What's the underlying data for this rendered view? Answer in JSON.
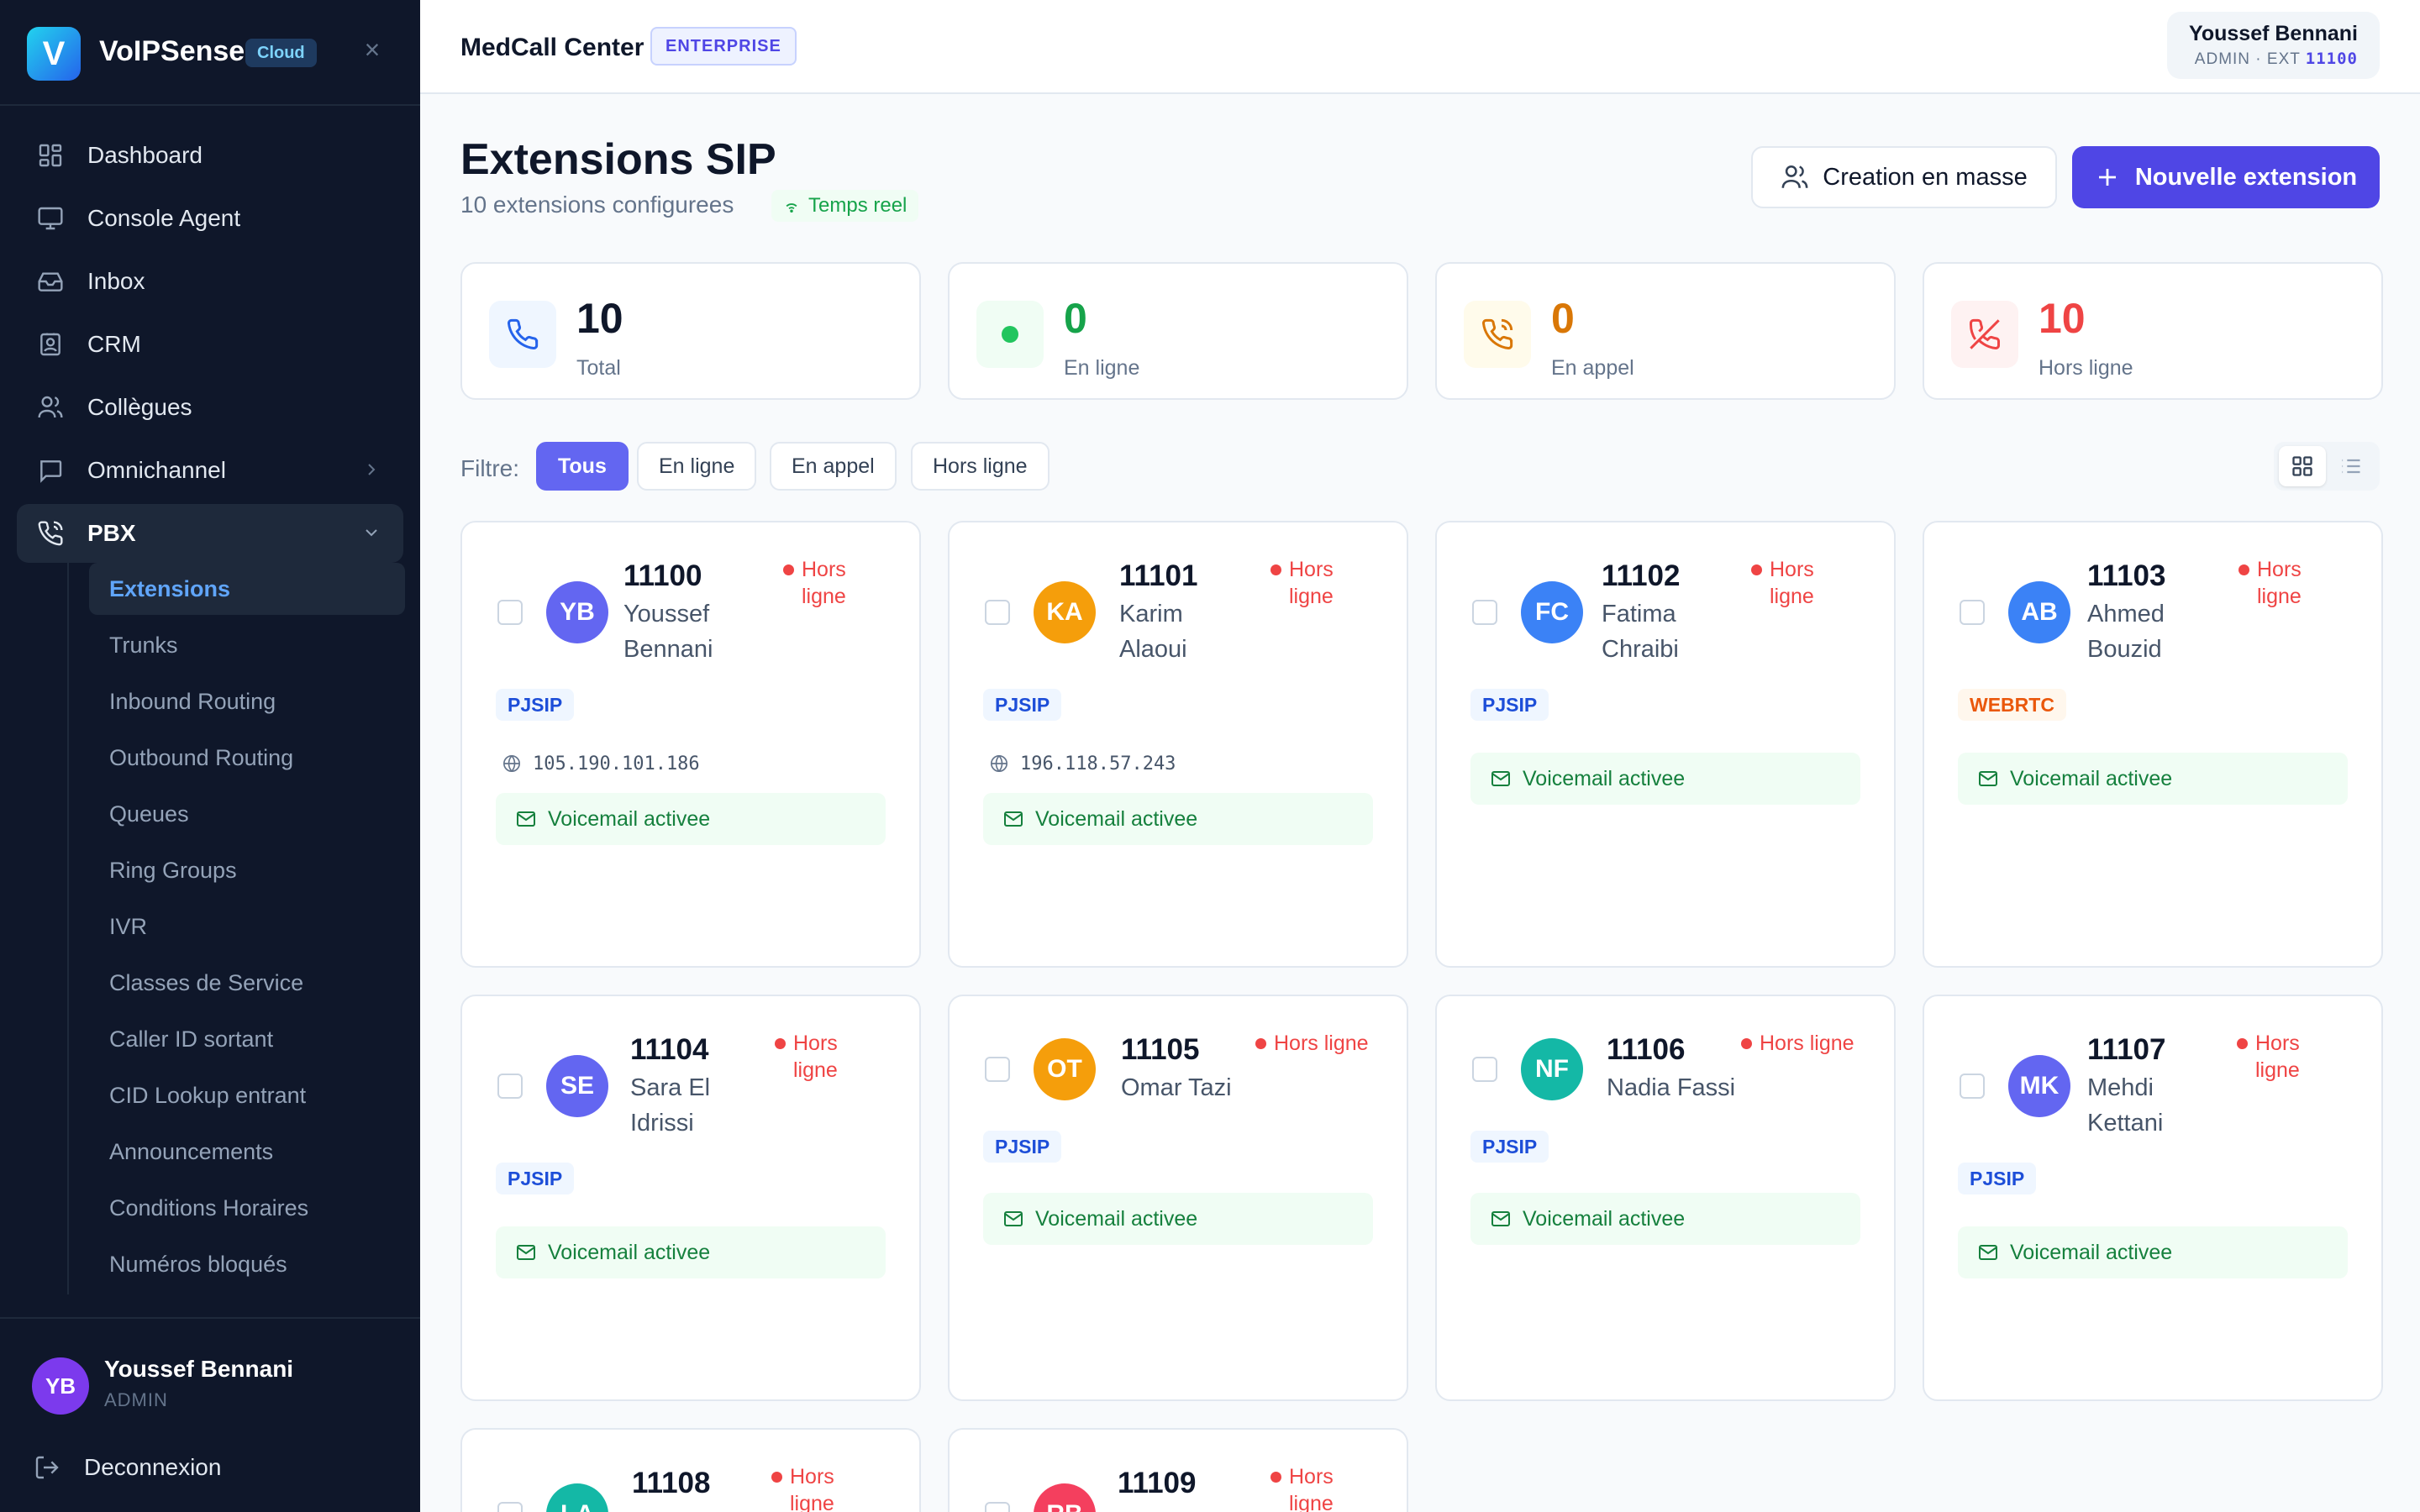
{
  "brand": {
    "logo": "V",
    "name": "VoIPSense",
    "badge": "Cloud",
    "close": "×"
  },
  "nav": [
    {
      "label": "Dashboard",
      "icon": "grid-icon"
    },
    {
      "label": "Console Agent",
      "icon": "monitor-icon"
    },
    {
      "label": "Inbox",
      "icon": "inbox-icon"
    },
    {
      "label": "CRM",
      "icon": "contact-icon"
    },
    {
      "label": "Collègues",
      "icon": "users-icon"
    },
    {
      "label": "Omnichannel",
      "icon": "chat-icon"
    },
    {
      "label": "PBX",
      "icon": "phone-icon"
    }
  ],
  "subnav": [
    "Extensions",
    "Trunks",
    "Inbound Routing",
    "Outbound Routing",
    "Queues",
    "Ring Groups",
    "IVR",
    "Classes de Service",
    "Caller ID sortant",
    "CID Lookup entrant",
    "Announcements",
    "Conditions Horaires",
    "Numéros bloqués"
  ],
  "sidebar_user": {
    "initials": "YB",
    "name": "Youssef Bennani",
    "role": "ADMIN",
    "logout": "Deconnexion"
  },
  "header": {
    "org": "MedCall Center",
    "plan": "ENTERPRISE",
    "user_name": "Youssef Bennani",
    "user_role": "ADMIN · EXT ",
    "user_ext": "11100"
  },
  "page": {
    "title": "Extensions SIP",
    "subtitle": "10 extensions configurees",
    "realtime": "Temps reel",
    "bulk_button": "Creation en masse",
    "new_button": "Nouvelle extension"
  },
  "stats": [
    {
      "value": "10",
      "label": "Total",
      "color": "#0f172a"
    },
    {
      "value": "0",
      "label": "En ligne",
      "color": "#16a34a"
    },
    {
      "value": "0",
      "label": "En appel",
      "color": "#d97706"
    },
    {
      "value": "10",
      "label": "Hors ligne",
      "color": "#ef4444"
    }
  ],
  "filter": {
    "label": "Filtre:",
    "options": [
      "Tous",
      "En ligne",
      "En appel",
      "Hors ligne"
    ],
    "selected": "Tous"
  },
  "extensions": [
    {
      "ext": "11100",
      "name": "Youssef Bennani",
      "initials": "YB",
      "color": "#6366f1",
      "status": "Hors ligne",
      "protocol": "PJSIP",
      "ip": "105.190.101.186",
      "voicemail": "Voicemail activee"
    },
    {
      "ext": "11101",
      "name": "Karim Alaoui",
      "initials": "KA",
      "color": "#f59e0b",
      "status": "Hors ligne",
      "protocol": "PJSIP",
      "ip": "196.118.57.243",
      "voicemail": "Voicemail activee"
    },
    {
      "ext": "11102",
      "name": "Fatima Chraibi",
      "initials": "FC",
      "color": "#3b82f6",
      "status": "Hors ligne",
      "protocol": "PJSIP",
      "ip": "",
      "voicemail": "Voicemail activee"
    },
    {
      "ext": "11103",
      "name": "Ahmed Bouzid",
      "initials": "AB",
      "color": "#3b82f6",
      "status": "Hors ligne",
      "protocol": "WEBRTC",
      "ip": "",
      "voicemail": "Voicemail activee"
    },
    {
      "ext": "11104",
      "name": "Sara El Idrissi",
      "initials": "SE",
      "color": "#6366f1",
      "status": "Hors ligne",
      "protocol": "PJSIP",
      "ip": "",
      "voicemail": "Voicemail activee"
    },
    {
      "ext": "11105",
      "name": "Omar Tazi",
      "initials": "OT",
      "color": "#f59e0b",
      "status": "Hors ligne",
      "protocol": "PJSIP",
      "ip": "",
      "voicemail": "Voicemail activee"
    },
    {
      "ext": "11106",
      "name": "Nadia Fassi",
      "initials": "NF",
      "color": "#14b8a6",
      "status": "Hors ligne",
      "protocol": "PJSIP",
      "ip": "",
      "voicemail": "Voicemail activee"
    },
    {
      "ext": "11107",
      "name": "Mehdi Kettani",
      "initials": "MK",
      "color": "#6366f1",
      "status": "Hors ligne",
      "protocol": "PJSIP",
      "ip": "",
      "voicemail": "Voicemail activee"
    },
    {
      "ext": "11108",
      "name": "",
      "initials": "LA",
      "color": "#14b8a6",
      "status": "Hors ligne",
      "protocol": "",
      "ip": "",
      "voicemail": ""
    },
    {
      "ext": "11109",
      "name": "",
      "initials": "RB",
      "color": "#f43f5e",
      "status": "Hors ligne",
      "protocol": "",
      "ip": "",
      "voicemail": ""
    }
  ]
}
